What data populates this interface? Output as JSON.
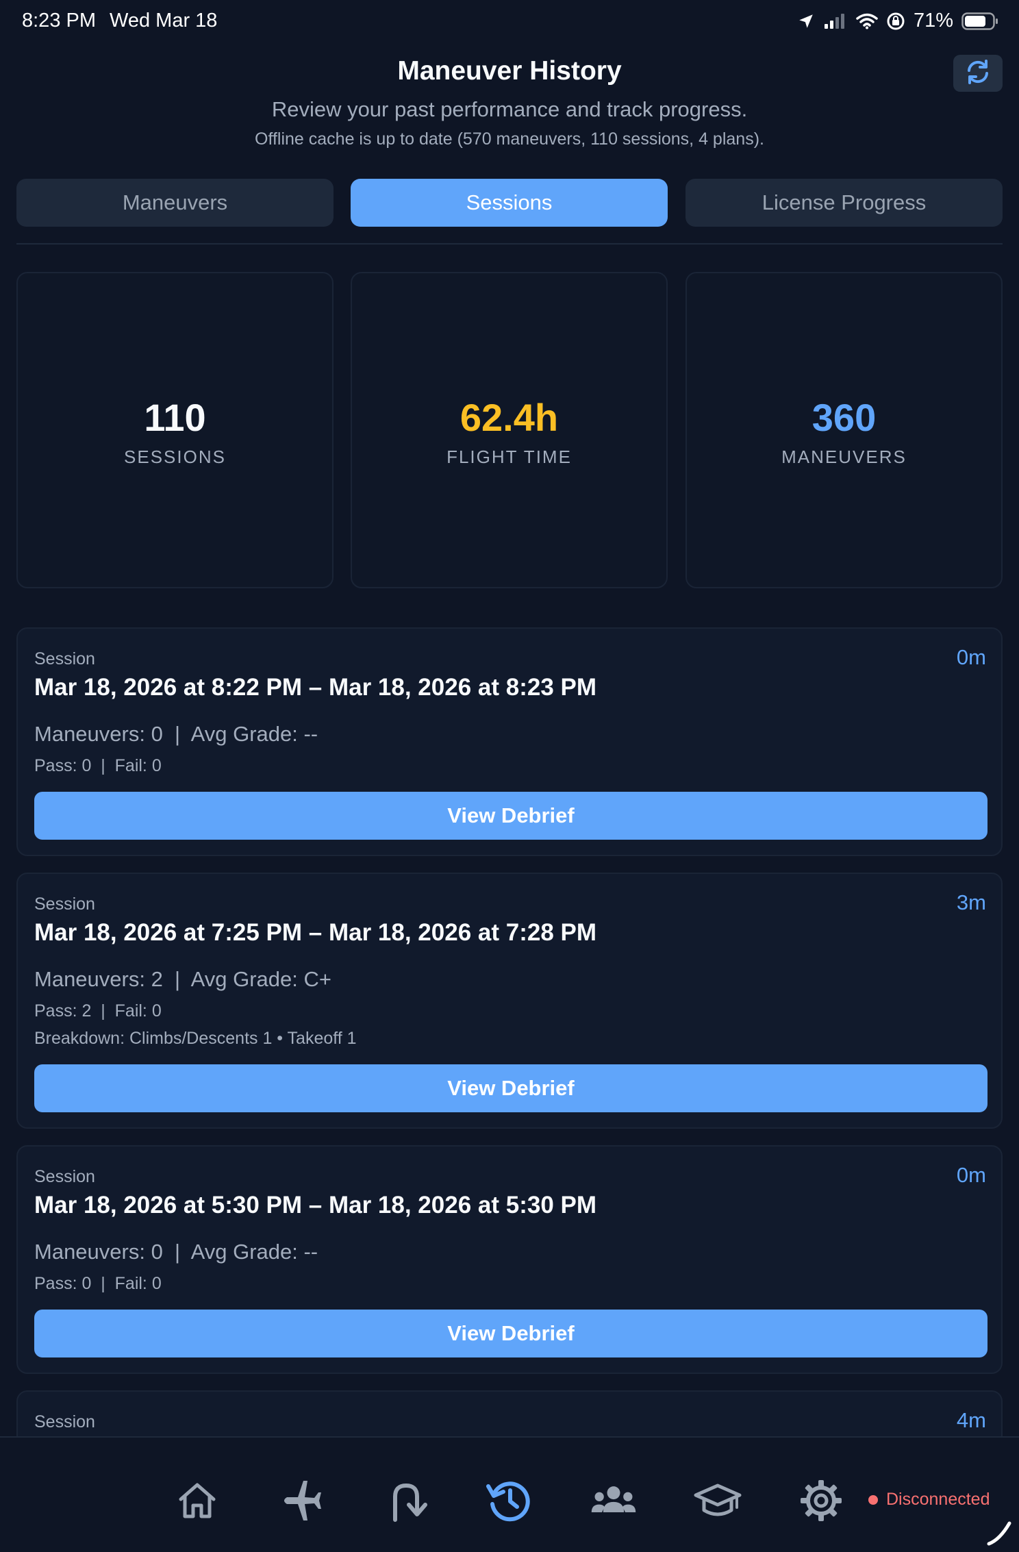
{
  "status_bar": {
    "time": "8:23 PM",
    "date": "Wed Mar 18",
    "battery": "71%"
  },
  "header": {
    "title": "Maneuver History",
    "subtitle": "Review your past performance and track progress.",
    "cache_status": "Offline cache is up to date (570 maneuvers, 110 sessions, 4 plans)."
  },
  "tabs": [
    {
      "label": "Maneuvers",
      "active": false
    },
    {
      "label": "Sessions",
      "active": true
    },
    {
      "label": "License Progress",
      "active": false
    }
  ],
  "stats": [
    {
      "value": "110",
      "label": "SESSIONS",
      "color": "#f8fafc"
    },
    {
      "value": "62.4h",
      "label": "FLIGHT TIME",
      "color": "#fbbf24"
    },
    {
      "value": "360",
      "label": "MANEUVERS",
      "color": "#60a5fa"
    }
  ],
  "sessions": [
    {
      "label": "Session",
      "duration": "0m",
      "range": "Mar 18, 2026 at 8:22 PM – Mar 18, 2026 at 8:23 PM",
      "summary": "Maneuvers: 0  |  Avg Grade: --",
      "pass_fail": "Pass: 0  |  Fail: 0",
      "breakdown": "",
      "button": "View Debrief"
    },
    {
      "label": "Session",
      "duration": "3m",
      "range": "Mar 18, 2026 at 7:25 PM – Mar 18, 2026 at 7:28 PM",
      "summary": "Maneuvers: 2  |  Avg Grade: C+",
      "pass_fail": "Pass: 2  |  Fail: 0",
      "breakdown": "Breakdown: Climbs/Descents 1 • Takeoff 1",
      "button": "View Debrief"
    },
    {
      "label": "Session",
      "duration": "0m",
      "range": "Mar 18, 2026 at 5:30 PM – Mar 18, 2026 at 5:30 PM",
      "summary": "Maneuvers: 0  |  Avg Grade: --",
      "pass_fail": "Pass: 0  |  Fail: 0",
      "breakdown": "",
      "button": "View Debrief"
    },
    {
      "label": "Session",
      "duration": "4m"
    }
  ],
  "nav": {
    "items": [
      "home-icon",
      "airplane-icon",
      "return-arrow-icon",
      "history-icon",
      "users-icon",
      "graduation-cap-icon",
      "gear-icon"
    ],
    "active": "history-icon",
    "connection_status": "Disconnected"
  },
  "colors": {
    "background": "#0e1525",
    "accent": "#60a5fa",
    "flight_time": "#fbbf24",
    "disconnected": "#f87171"
  }
}
